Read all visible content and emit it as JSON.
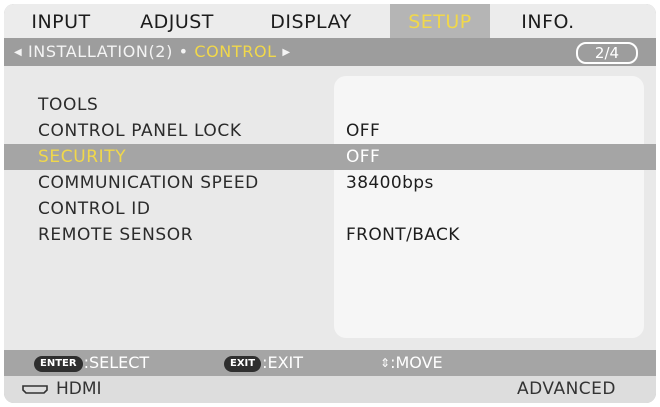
{
  "tabs": [
    {
      "label": "INPUT",
      "active": false
    },
    {
      "label": "ADJUST",
      "active": false
    },
    {
      "label": "DISPLAY",
      "active": false
    },
    {
      "label": "SETUP",
      "active": true
    },
    {
      "label": "INFO.",
      "active": false
    }
  ],
  "subheader": {
    "section": "INSTALLATION(2)",
    "separator": "•",
    "current": "CONTROL",
    "page": "2/4"
  },
  "rows": [
    {
      "label": "TOOLS",
      "value": ""
    },
    {
      "label": "CONTROL PANEL LOCK",
      "value": "OFF"
    },
    {
      "label": "SECURITY",
      "value": "OFF",
      "selected": true
    },
    {
      "label": "COMMUNICATION SPEED",
      "value": "38400bps"
    },
    {
      "label": "CONTROL ID",
      "value": ""
    },
    {
      "label": "REMOTE SENSOR",
      "value": "FRONT/BACK"
    }
  ],
  "hints": {
    "enter_key": "ENTER",
    "enter_text": ":SELECT",
    "exit_key": "EXIT",
    "exit_text": ":EXIT",
    "move_text": ":MOVE"
  },
  "status": {
    "source": "HDMI",
    "mode": "ADVANCED"
  },
  "colors": {
    "highlight": "#f1d84a",
    "bar": "#a5a5a5",
    "background": "#e9e9e9"
  },
  "icons": {
    "left_arrow": "triangle-left-icon",
    "right_arrow": "triangle-right-icon",
    "move": "up-down-icon",
    "input_source": "hdmi-connector-icon"
  }
}
